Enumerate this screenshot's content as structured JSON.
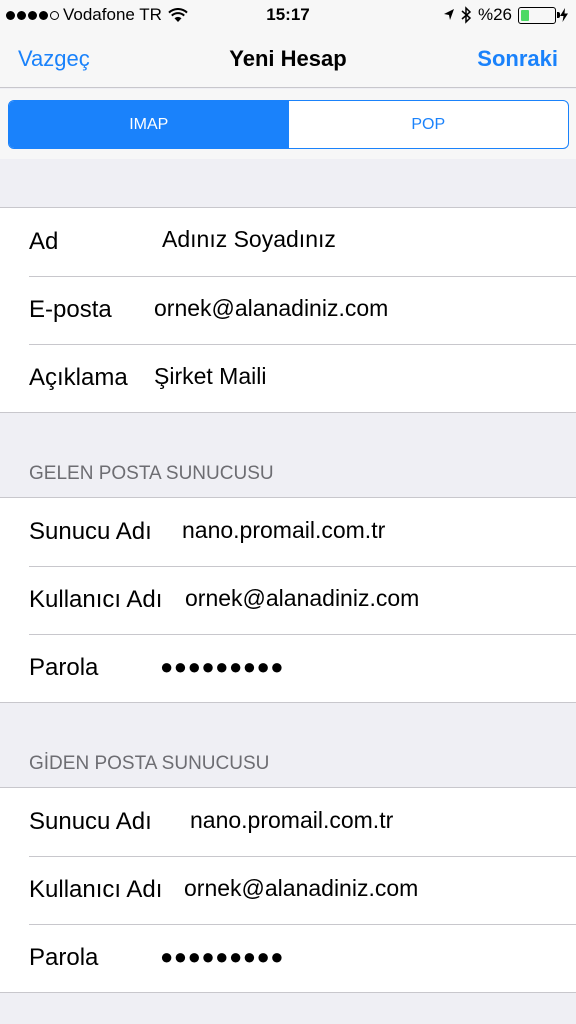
{
  "status_bar": {
    "carrier": "Vodafone TR",
    "time": "15:17",
    "battery": "%26",
    "battery_level": 0.26,
    "icons": [
      "wifi-icon",
      "location-icon",
      "bluetooth-icon",
      "battery-icon",
      "charging-bolt-icon"
    ]
  },
  "nav": {
    "cancel": "Vazgeç",
    "title": "Yeni Hesap",
    "next": "Sonraki"
  },
  "segment": {
    "options": [
      "IMAP",
      "POP"
    ],
    "selected": "IMAP"
  },
  "account": [
    {
      "label": "Ad",
      "value": "Adınız Soyadınız"
    },
    {
      "label": "E-posta",
      "value": "ornek@alanadiniz.com"
    },
    {
      "label": "Açıklama",
      "value": "Şirket Maili"
    }
  ],
  "incoming": {
    "header": "GELEN POSTA SUNUCUSU",
    "rows": [
      {
        "label": "Sunucu Adı",
        "value": "nano.promail.com.tr"
      },
      {
        "label": "Kullanıcı Adı",
        "value": "ornek@alanadiniz.com"
      },
      {
        "label": "Parola",
        "value": "●●●●●●●●●"
      }
    ]
  },
  "outgoing": {
    "header": "GİDEN POSTA SUNUCUSU",
    "rows": [
      {
        "label": "Sunucu Adı",
        "value": "nano.promail.com.tr"
      },
      {
        "label": "Kullanıcı Adı",
        "value": "ornek@alanadiniz.com"
      },
      {
        "label": "Parola",
        "value": "●●●●●●●●●"
      }
    ]
  },
  "colors": {
    "accent": "#1a82fb",
    "background": "#efeff4",
    "separator": "#c8c7cc",
    "section_header": "#6d6d72",
    "battery_fill": "#4cd964"
  }
}
